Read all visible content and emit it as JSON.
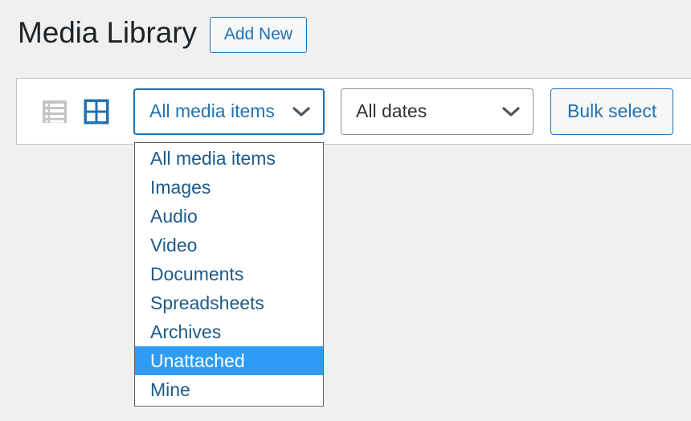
{
  "header": {
    "title": "Media Library",
    "add_new_label": "Add New"
  },
  "toolbar": {
    "view_list_icon": "list-view-icon",
    "view_grid_icon": "grid-view-icon",
    "media_type_select": {
      "value": "All media items",
      "chevron_icon": "chevron-down-icon",
      "options": [
        "All media items",
        "Images",
        "Audio",
        "Video",
        "Documents",
        "Spreadsheets",
        "Archives",
        "Unattached",
        "Mine"
      ],
      "selected_option": "Unattached",
      "expanded": true
    },
    "dates_select": {
      "value": "All dates",
      "chevron_icon": "chevron-down-icon"
    },
    "bulk_select_label": "Bulk select"
  },
  "colors": {
    "page_background": "#f0f0f1",
    "panel_background": "#ffffff",
    "panel_border": "#c3c4c7",
    "accent_blue": "#2271b1",
    "highlight_blue": "#2e9cf5",
    "text_dark": "#1d2327",
    "icon_inactive": "#c3c4c7",
    "chevron": "#50575e",
    "option_text": "#1d5a8a",
    "dropdown_border": "#6b5b5b"
  }
}
